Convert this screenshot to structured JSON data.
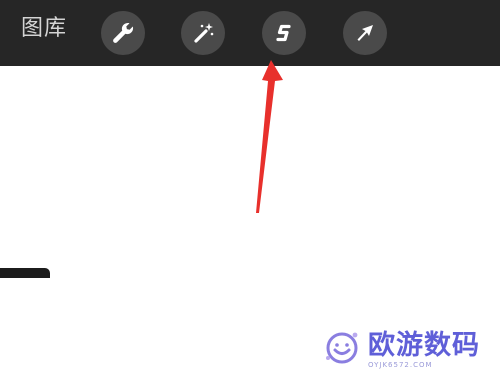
{
  "toolbar": {
    "gallery_label": "图库",
    "tools": [
      {
        "name": "actions",
        "icon": "wrench-icon"
      },
      {
        "name": "adjustments",
        "icon": "magic-wand-icon"
      },
      {
        "name": "selection",
        "icon": "selection-s-icon"
      },
      {
        "name": "transform",
        "icon": "transform-arrow-icon"
      }
    ]
  },
  "annotation": {
    "type": "arrow",
    "color": "#e8302c",
    "points_to": "selection"
  },
  "watermark": {
    "title": "欧游数码",
    "url": "OYJK6572.COM",
    "color": "#5f5fd8"
  },
  "colors": {
    "toolbar_bg": "#262626",
    "button_bg": "#4a4a4a",
    "icon": "#ffffff",
    "canvas": "#ffffff"
  }
}
